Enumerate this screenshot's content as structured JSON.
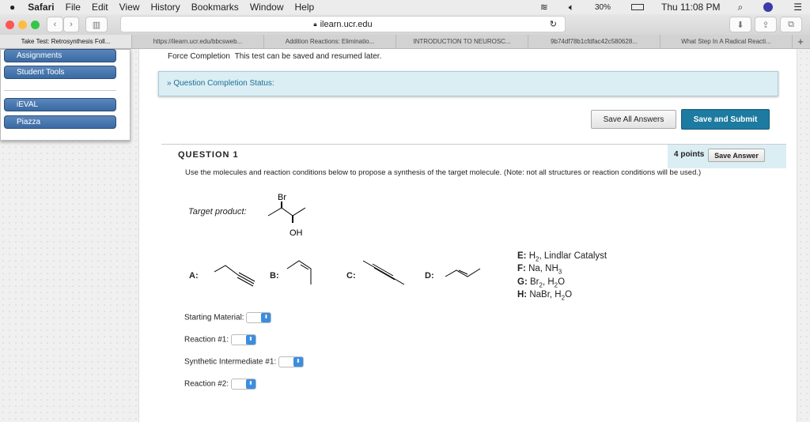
{
  "menubar": {
    "apple": "",
    "items": [
      "Safari",
      "File",
      "Edit",
      "View",
      "History",
      "Bookmarks",
      "Window",
      "Help"
    ],
    "battery": "30%",
    "clock": "Thu 11:08 PM"
  },
  "toolbar": {
    "url": "ilearn.ucr.edu"
  },
  "tabs": [
    "Take Test: Retrosynthesis Foll...",
    "https://ilearn.ucr.edu/bbcsweb...",
    "Addition Reactions: Eliminatio...",
    "INTRODUCTION TO NEUROSC...",
    "9b74df78b1cfdfac42c580628...",
    "What Step In A Radical Reacti...",
    "+"
  ],
  "sidebar": {
    "items": [
      "Assignments",
      "Student Tools",
      "iEVAL",
      "Piazza"
    ]
  },
  "main": {
    "force_label": "Force Completion",
    "force_text": "This test can be saved and resumed later.",
    "completion_status": "Question Completion Status:",
    "save_all": "Save All Answers",
    "save_submit": "Save and Submit",
    "question": {
      "title": "QUESTION 1",
      "points": "4 points",
      "save_answer": "Save Answer",
      "prompt": "Use the molecules and reaction conditions below to propose a synthesis of the target molecule. (Note: not all structures or reaction conditions will be used.)",
      "target_label": "Target product:",
      "br": "Br",
      "oh": "OH",
      "molecules": [
        "A:",
        "B:",
        "C:",
        "D:"
      ],
      "conditions": [
        {
          "key": "E:",
          "text": "H",
          "sub": "2",
          "rest": ", Lindlar Catalyst"
        },
        {
          "key": "F:",
          "text": "Na, NH",
          "sub": "3",
          "rest": ""
        },
        {
          "key": "G:",
          "text": "Br",
          "sub": "2",
          "rest": ", H",
          "sub2": "2",
          "rest2": "O"
        },
        {
          "key": "H:",
          "text": "NaBr, H",
          "sub": "2",
          "rest": "O"
        }
      ],
      "fields": [
        "Starting Material:",
        "Reaction #1:",
        "Synthetic Intermediate #1:",
        "Reaction #2:"
      ]
    }
  }
}
